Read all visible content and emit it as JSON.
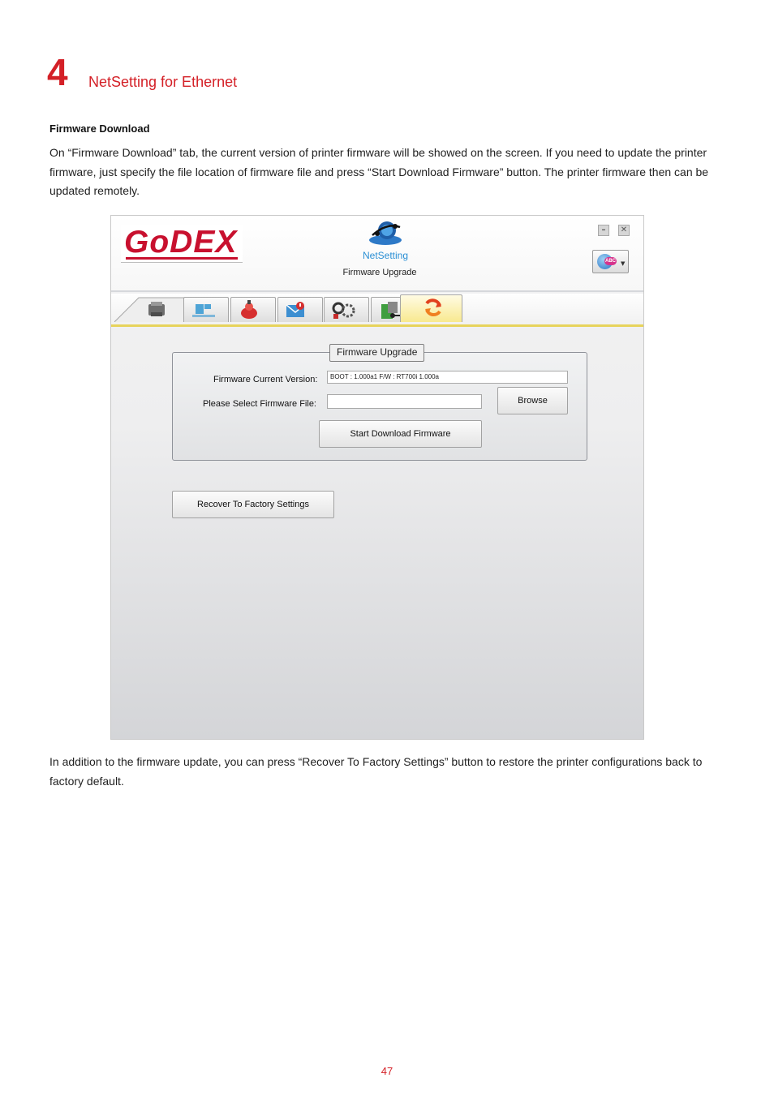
{
  "chapter": {
    "number": "4",
    "title": "NetSetting for Ethernet"
  },
  "section": {
    "heading": "Firmware Download"
  },
  "intro_paragraph": "On “Firmware Download” tab, the current version of printer firmware will be showed on the screen. If you need to update the printer firmware, just specify the file location of firmware file and press “Start Download Firmware” button. The printer firmware then can be updated remotely.",
  "app": {
    "logo_text": "GoDEX",
    "product_name": "NetSetting",
    "subtitle": "Firmware Upgrade",
    "window_controls": {
      "minimize": "–",
      "close": "✕"
    },
    "language_badge": "ABC",
    "tabs": [
      {
        "name": "printer",
        "icon": "printer-icon"
      },
      {
        "name": "network",
        "icon": "network-icon"
      },
      {
        "name": "alert",
        "icon": "alarm-icon"
      },
      {
        "name": "email",
        "icon": "mail-alert-icon"
      },
      {
        "name": "settings",
        "icon": "gears-icon"
      },
      {
        "name": "key",
        "icon": "key-icon"
      },
      {
        "name": "firmware-upgrade",
        "icon": "refresh-arrows-icon",
        "active": true
      }
    ],
    "group": {
      "legend": "Firmware Upgrade",
      "version_label": "Firmware Current Version:",
      "version_value": "BOOT : 1.000a1 F/W : RT700i 1.000a",
      "file_label": "Please Select Firmware File:",
      "file_value": "",
      "browse_label": "Browse",
      "download_label": "Start Download Firmware"
    },
    "recover_label": "Recover To Factory  Settings",
    "colors": {
      "brand_red": "#c8102e",
      "tab_active": "#f8e98f",
      "accent_line": "#e7d35b"
    }
  },
  "outro_paragraph": "In addition to the firmware update, you can press “Recover To Factory Settings” button to restore the printer configurations back to factory default.",
  "page_number": "47"
}
